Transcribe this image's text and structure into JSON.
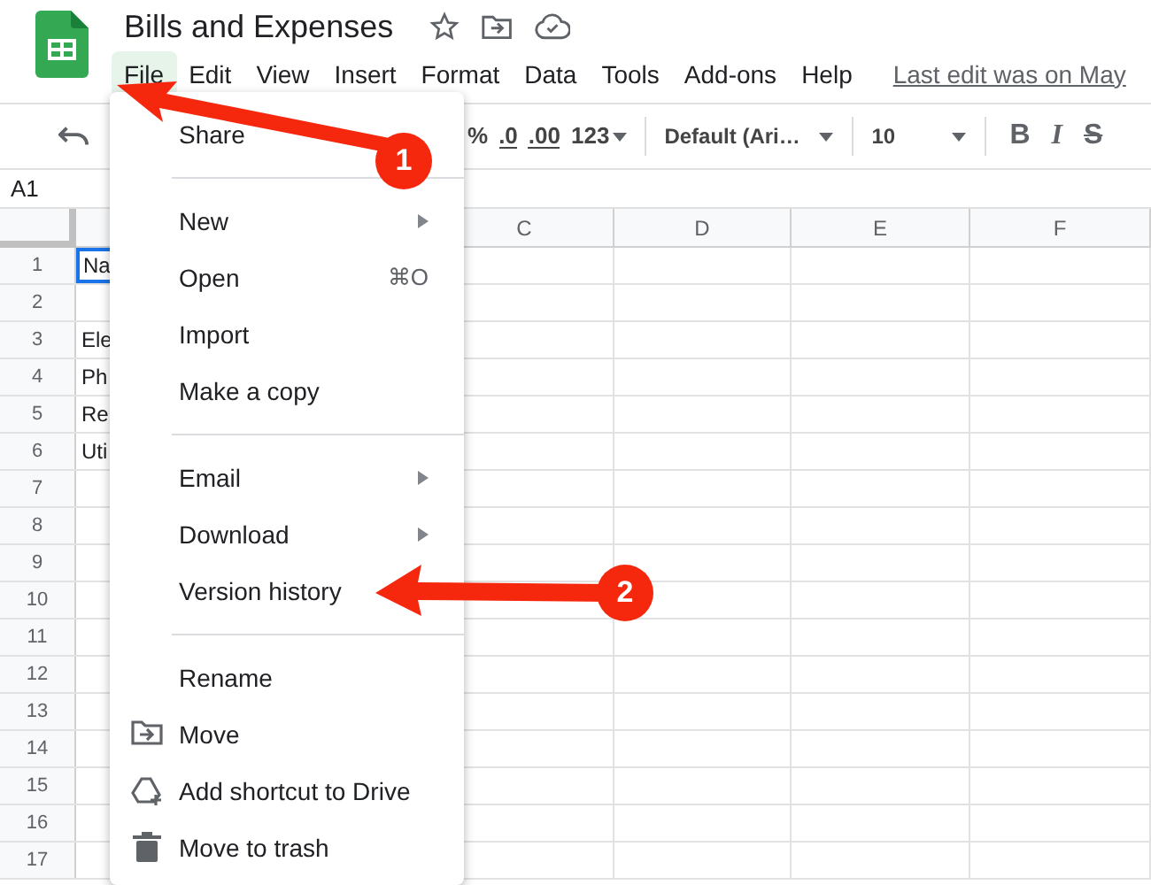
{
  "document": {
    "title": "Bills and Expenses"
  },
  "menu_bar": [
    {
      "label": "File",
      "selected": true
    },
    {
      "label": "Edit",
      "selected": false
    },
    {
      "label": "View",
      "selected": false
    },
    {
      "label": "Insert",
      "selected": false
    },
    {
      "label": "Format",
      "selected": false
    },
    {
      "label": "Data",
      "selected": false
    },
    {
      "label": "Tools",
      "selected": false
    },
    {
      "label": "Add-ons",
      "selected": false
    },
    {
      "label": "Help",
      "selected": false
    }
  ],
  "last_edit": "Last edit was on May",
  "toolbar": {
    "percent": "%",
    "decrease_decimals": ".0",
    "increase_decimals": ".00",
    "number_format": "123",
    "font": "Default (Ari…",
    "font_size": "10",
    "bold": "B",
    "italic": "I",
    "strikethrough": "S"
  },
  "name_box": "A1",
  "columns": [
    "C",
    "D",
    "E",
    "F"
  ],
  "rows": [
    {
      "number": "1",
      "cell_a": "Na",
      "selected": true
    },
    {
      "number": "2",
      "selected": false
    },
    {
      "number": "3",
      "cell_a": "Ele",
      "selected": false
    },
    {
      "number": "4",
      "cell_a": "Ph",
      "selected": false
    },
    {
      "number": "5",
      "cell_a": "Re",
      "selected": false
    },
    {
      "number": "6",
      "cell_a": "Uti",
      "selected": false
    },
    {
      "number": "7",
      "selected": false
    },
    {
      "number": "8",
      "selected": false
    },
    {
      "number": "9",
      "selected": false
    },
    {
      "number": "10",
      "selected": false
    },
    {
      "number": "11",
      "selected": false
    },
    {
      "number": "12",
      "selected": false
    },
    {
      "number": "13",
      "selected": false
    },
    {
      "number": "14",
      "selected": false
    },
    {
      "number": "15",
      "selected": false
    },
    {
      "number": "16",
      "selected": false
    },
    {
      "number": "17",
      "selected": false
    }
  ],
  "file_menu": [
    {
      "kind": "item",
      "label": "Share"
    },
    {
      "kind": "divider"
    },
    {
      "kind": "item",
      "label": "New",
      "submenu": true
    },
    {
      "kind": "item",
      "label": "Open",
      "shortcut": "⌘O"
    },
    {
      "kind": "item",
      "label": "Import"
    },
    {
      "kind": "item",
      "label": "Make a copy"
    },
    {
      "kind": "divider"
    },
    {
      "kind": "item",
      "label": "Email",
      "submenu": true
    },
    {
      "kind": "item",
      "label": "Download",
      "submenu": true
    },
    {
      "kind": "item",
      "label": "Version history"
    },
    {
      "kind": "divider"
    },
    {
      "kind": "item",
      "label": "Rename"
    },
    {
      "kind": "move",
      "label": "Move"
    },
    {
      "kind": "shortcut",
      "label": "Add shortcut to Drive"
    },
    {
      "kind": "trash",
      "label": "Move to trash"
    }
  ],
  "callouts": [
    "1",
    "2"
  ]
}
